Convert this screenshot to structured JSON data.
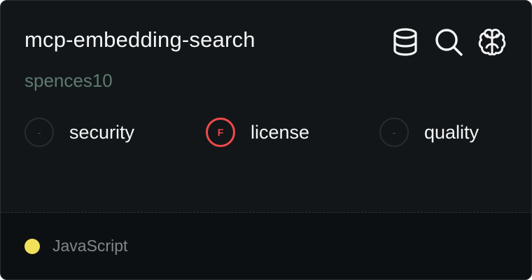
{
  "repo": {
    "name": "mcp-embedding-search",
    "owner": "spences10"
  },
  "header_icons": [
    {
      "name": "database-icon"
    },
    {
      "name": "search-icon"
    },
    {
      "name": "brain-icon"
    }
  ],
  "metrics": {
    "security": {
      "label": "security",
      "grade": "-",
      "status": "none"
    },
    "license": {
      "label": "license",
      "grade": "F",
      "status": "fail",
      "color": "#ef4a4a"
    },
    "quality": {
      "label": "quality",
      "grade": "-",
      "status": "none"
    }
  },
  "footer": {
    "language": "JavaScript",
    "language_color": "#f1e05a"
  }
}
